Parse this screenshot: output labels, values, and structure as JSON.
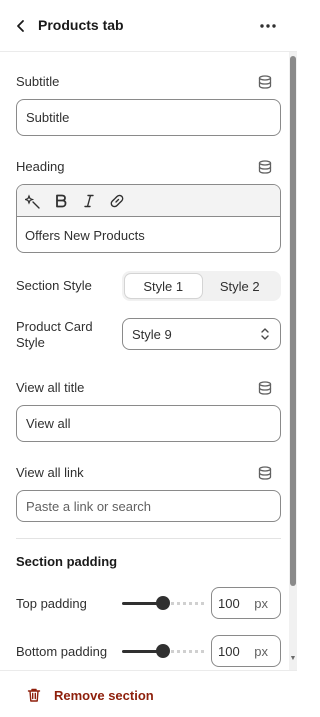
{
  "header": {
    "title": "Products tab",
    "back_icon": "chevron-left-icon",
    "more_icon": "ellipsis-horizontal-icon"
  },
  "subtitle": {
    "label": "Subtitle",
    "value": "Subtitle"
  },
  "heading": {
    "label": "Heading",
    "value": "Offers New Products",
    "toolbar": [
      "magic-icon",
      "bold-icon",
      "italic-icon",
      "link-icon"
    ]
  },
  "section_style": {
    "label": "Section Style",
    "options": [
      "Style 1",
      "Style 2"
    ],
    "selected": "Style 1"
  },
  "product_card_style": {
    "label_line1": "Product Card",
    "label_line2": "Style",
    "value": "Style 9"
  },
  "view_all_title": {
    "label": "View all title",
    "value": "View all"
  },
  "view_all_link": {
    "label": "View all link",
    "placeholder": "Paste a link or search"
  },
  "section_padding": {
    "title": "Section padding",
    "top": {
      "label": "Top padding",
      "value": "100",
      "unit": "px",
      "level": 0.5
    },
    "bottom": {
      "label": "Bottom padding",
      "value": "100",
      "unit": "px",
      "level": 0.5
    }
  },
  "footer": {
    "remove_label": "Remove section"
  },
  "colors": {
    "danger": "#8e1f0b",
    "text": "#303030",
    "border": "#8a8a8a"
  }
}
